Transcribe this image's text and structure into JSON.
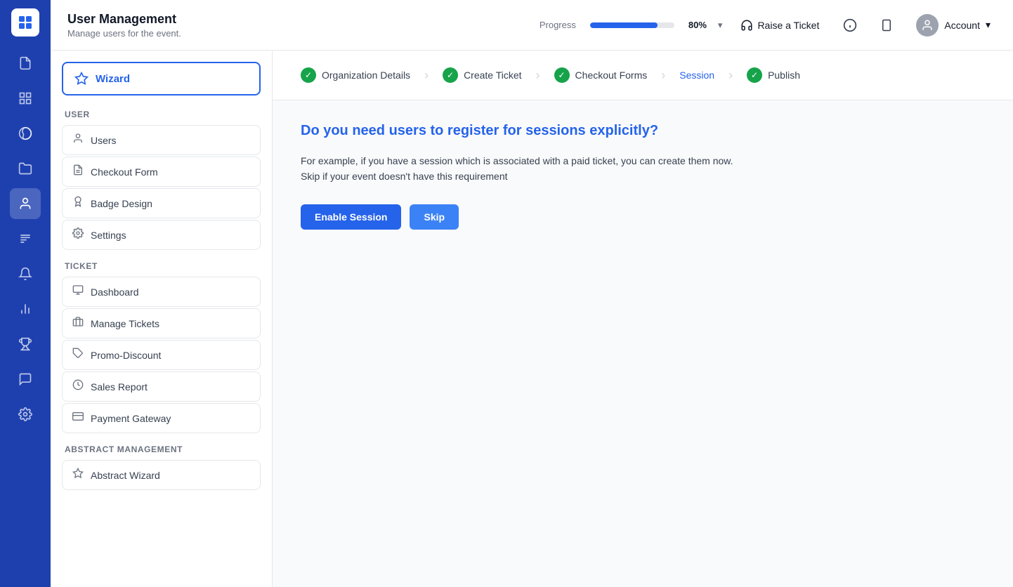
{
  "app": {
    "logo_text": "≡"
  },
  "header": {
    "title": "User Management",
    "subtitle": "Manage users for the event.",
    "progress_label": "Progress",
    "progress_value": 80,
    "progress_percent": "80%",
    "raise_ticket_label": "Raise a Ticket",
    "account_label": "Account"
  },
  "icon_nav": {
    "items": [
      {
        "name": "file-icon",
        "icon": "🗋",
        "active": false
      },
      {
        "name": "grid-icon",
        "icon": "⊞",
        "active": false
      },
      {
        "name": "palette-icon",
        "icon": "🎨",
        "active": false
      },
      {
        "name": "folder-icon",
        "icon": "🗁",
        "active": false
      },
      {
        "name": "user-icon",
        "icon": "👤",
        "active": true
      },
      {
        "name": "report-icon",
        "icon": "▤",
        "active": false
      },
      {
        "name": "bell-icon",
        "icon": "🔔",
        "active": false
      },
      {
        "name": "chart-icon",
        "icon": "📊",
        "active": false
      },
      {
        "name": "trophy-icon",
        "icon": "🏆",
        "active": false
      },
      {
        "name": "chat-icon",
        "icon": "💬",
        "active": false
      },
      {
        "name": "settings-icon",
        "icon": "⚙",
        "active": false
      }
    ]
  },
  "sidebar": {
    "wizard_label": "Wizard",
    "sections": [
      {
        "label": "User",
        "items": [
          {
            "name": "users",
            "icon": "👤",
            "label": "Users"
          },
          {
            "name": "checkout-form",
            "icon": "📄",
            "label": "Checkout Form"
          },
          {
            "name": "badge-design",
            "icon": "🏅",
            "label": "Badge Design"
          },
          {
            "name": "settings",
            "icon": "⚙",
            "label": "Settings"
          }
        ]
      },
      {
        "label": "Ticket",
        "items": [
          {
            "name": "dashboard",
            "icon": "🖥",
            "label": "Dashboard"
          },
          {
            "name": "manage-tickets",
            "icon": "🎟",
            "label": "Manage Tickets"
          },
          {
            "name": "promo-discount",
            "icon": "🏷",
            "label": "Promo-Discount"
          },
          {
            "name": "sales-report",
            "icon": "⏱",
            "label": "Sales Report"
          },
          {
            "name": "payment-gateway",
            "icon": "💳",
            "label": "Payment Gateway"
          }
        ]
      },
      {
        "label": "Abstract Management",
        "items": [
          {
            "name": "abstract-wizard",
            "icon": "◈",
            "label": "Abstract Wizard"
          }
        ]
      }
    ]
  },
  "wizard_steps": [
    {
      "name": "organization-details",
      "label": "Organization Details",
      "completed": true,
      "active": false
    },
    {
      "name": "create-ticket",
      "label": "Create Ticket",
      "completed": true,
      "active": false
    },
    {
      "name": "checkout-forms",
      "label": "Checkout Forms",
      "completed": true,
      "active": false
    },
    {
      "name": "session",
      "label": "Session",
      "completed": false,
      "active": true
    },
    {
      "name": "publish",
      "label": "Publish",
      "completed": true,
      "active": false
    }
  ],
  "content": {
    "title": "Do you need users to register for sessions explicitly?",
    "description_line1": "For example, if you have a session which is associated with a paid ticket, you can create them now.",
    "description_line2": "Skip if your event doesn't have this requirement",
    "enable_session_label": "Enable Session",
    "skip_label": "Skip"
  }
}
